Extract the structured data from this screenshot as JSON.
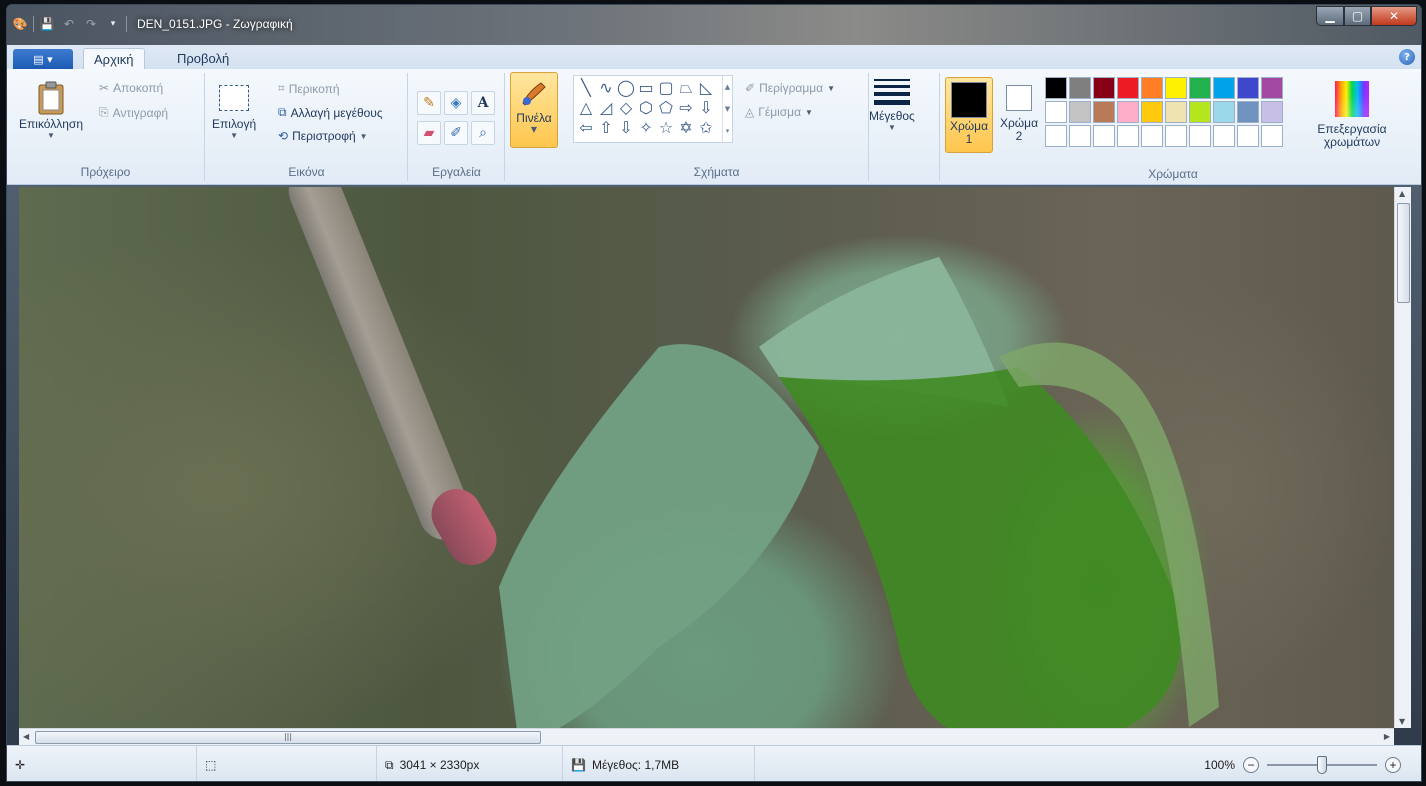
{
  "window": {
    "title": "DEN_0151.JPG - Ζωγραφική"
  },
  "tabs": [
    {
      "label": "Αρχική",
      "active": true
    },
    {
      "label": "Προβολή",
      "active": false
    }
  ],
  "clipboard": {
    "paste": "Επικόλληση",
    "cut": "Αποκοπή",
    "copy": "Αντιγραφή",
    "label": "Πρόχειρο"
  },
  "image": {
    "select": "Επιλογή",
    "crop": "Περικοπή",
    "resize": "Αλλαγή μεγέθους",
    "rotate": "Περιστροφή",
    "label": "Εικόνα"
  },
  "tools": {
    "label": "Εργαλεία"
  },
  "brushes": {
    "label": "Πινέλα"
  },
  "shapes": {
    "outline": "Περίγραμμα",
    "fill": "Γέμισμα",
    "label": "Σχήματα",
    "glyphs": [
      "╲",
      "∿",
      "◯",
      "▭",
      "▢",
      "⏢",
      "◺",
      "△",
      "◿",
      "◇",
      "⬡",
      "⬠",
      "⇨",
      "⇩",
      "⇦",
      "⇧",
      "⇩",
      "✧",
      "☆",
      "✡",
      "✩"
    ]
  },
  "size": {
    "label": "Μέγεθος"
  },
  "colors": {
    "color1_label": "Χρώμα",
    "color1_num": "1",
    "color2_label": "Χρώμα",
    "color2_num": "2",
    "color1_value": "#000000",
    "color2_value": "#ffffff",
    "edit_line1": "Επεξεργασία",
    "edit_line2": "χρωμάτων",
    "label": "Χρώματα",
    "palette": [
      "#000000",
      "#7f7f7f",
      "#880015",
      "#ed1c24",
      "#ff7f27",
      "#fff200",
      "#22b14c",
      "#00a2e8",
      "#3f48cc",
      "#a349a4",
      "#ffffff",
      "#c3c3c3",
      "#b97a57",
      "#ffaec9",
      "#ffc90e",
      "#efe4b0",
      "#b5e61d",
      "#99d9ea",
      "#7092be",
      "#c8bfe7",
      "#ffffff",
      "#ffffff",
      "#ffffff",
      "#ffffff",
      "#ffffff",
      "#ffffff",
      "#ffffff",
      "#ffffff",
      "#ffffff",
      "#ffffff"
    ]
  },
  "status": {
    "dimensions": "3041 × 2330px",
    "filesize": "Μέγεθος: 1,7MB",
    "zoom": "100%",
    "zoom_fraction": 0.5
  }
}
